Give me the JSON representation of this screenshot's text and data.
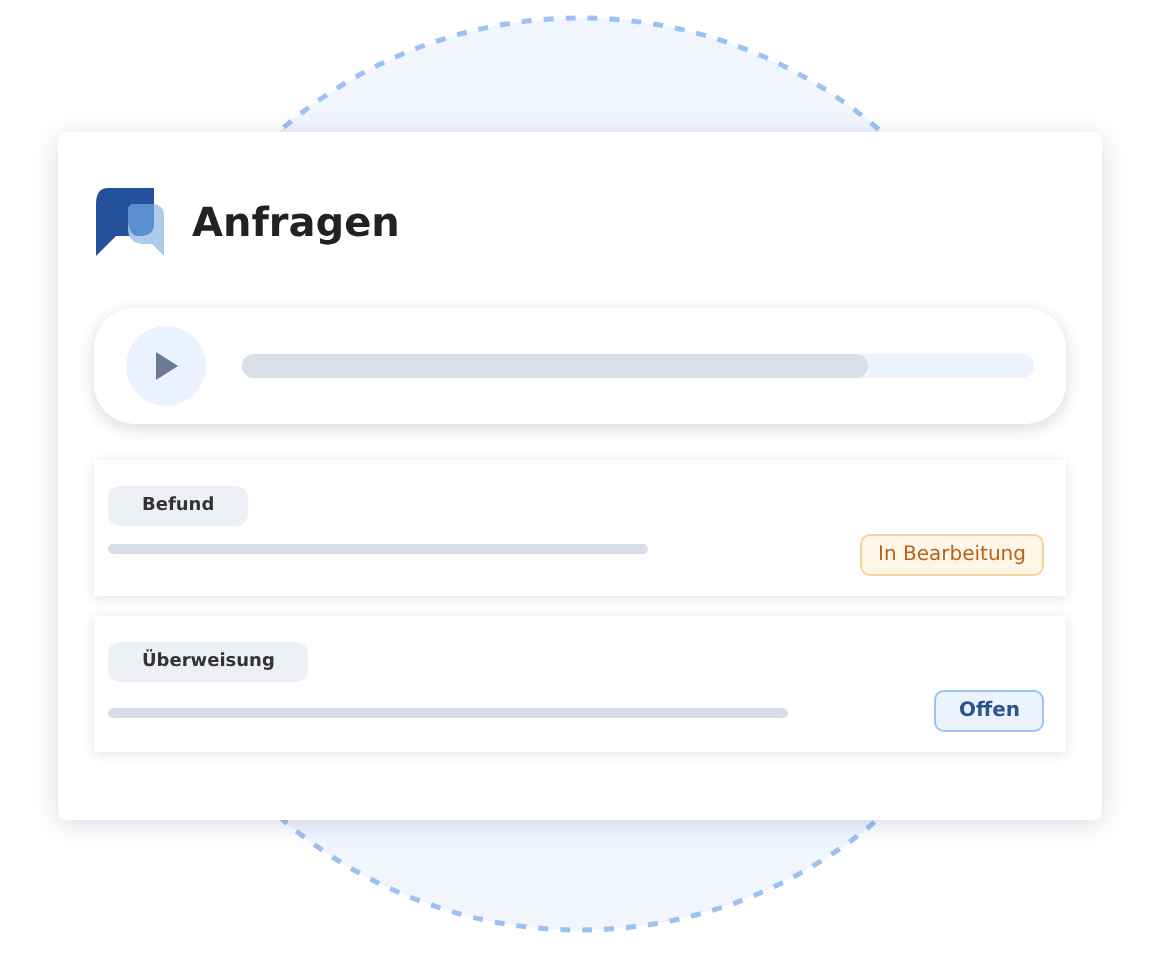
{
  "header": {
    "title": "Anfragen"
  },
  "player": {
    "playing": false,
    "level": 0.79
  },
  "requests": [
    {
      "label": "Befund",
      "status": {
        "kind": "in_progress",
        "text": "In Bearbeitung"
      }
    },
    {
      "label": "Überweisung",
      "status": {
        "kind": "open",
        "text": "Offen"
      }
    }
  ]
}
